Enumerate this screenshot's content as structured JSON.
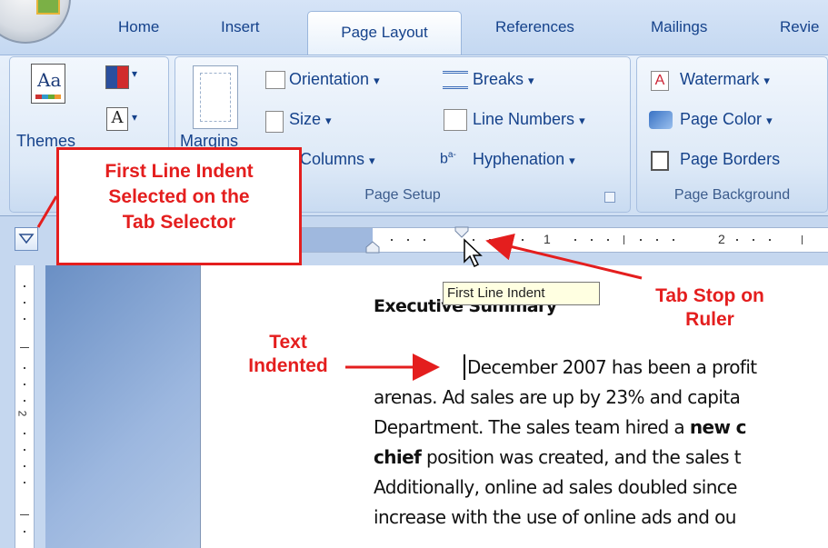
{
  "tabs": [
    "Home",
    "Insert",
    "Page Layout",
    "References",
    "Mailings",
    "Revie"
  ],
  "ribbon": {
    "themes_label": "Themes",
    "theme_preview": "Aa",
    "theme_font_glyph": "A",
    "margins_label": "Margins",
    "orientation": "Orientation",
    "size": "Size",
    "columns": "Columns",
    "breaks": "Breaks",
    "line_numbers": "Line Numbers",
    "hyphenation": "Hyphenation",
    "page_setup_label": "Page Setup",
    "watermark": "Watermark",
    "page_color": "Page Color",
    "page_borders": "Page Borders",
    "page_background_label": "Page Background",
    "dropdown_arrow": "▾"
  },
  "ruler": {
    "number_1": "1",
    "number_2": "2"
  },
  "vertical_ruler_number": "2",
  "tooltip": "First Line Indent",
  "document": {
    "heading": "Executive Summary",
    "lines": [
      {
        "text": "December 2007 has been a profit"
      },
      {
        "text": "arenas. Ad sales are up by 23% and capita"
      },
      {
        "pre": "Department. The sales team hired a ",
        "bold": "new c"
      },
      {
        "bold": "chief",
        "post": " position was created, and the sales t"
      },
      {
        "text": "Additionally, online ad sales doubled since"
      },
      {
        "text": "increase with the use of online ads and ou"
      }
    ]
  },
  "annotations": {
    "callout_line1": "First Line Indent",
    "callout_line2": "Selected on the",
    "callout_line3": "Tab Selector",
    "tabstop_line1": "Tab Stop on",
    "tabstop_line2": "Ruler",
    "indent_line1": "Text",
    "indent_line2": "Indented"
  },
  "colors": {
    "annotation_red": "#e41e1e",
    "ribbon_text": "#15428b",
    "ribbon_bg": "#dbe7f6"
  }
}
